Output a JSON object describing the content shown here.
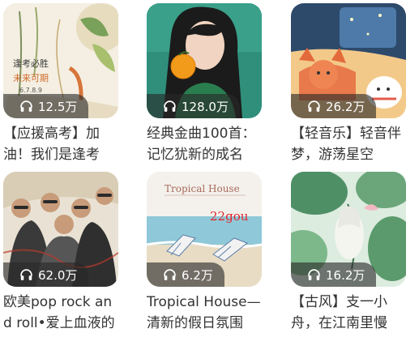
{
  "playlists": [
    {
      "play_count": "12.5万",
      "title": "【应援高考】加油！我们是逢考",
      "cover_icon": "cover-art-exam",
      "cover_text": {
        "line1": "逢考必胜",
        "line2": "未来可期",
        "line3": "6.7.8.9"
      }
    },
    {
      "play_count": "128.0万",
      "title": "经典金曲100首：记忆犹新的成名",
      "cover_icon": "cover-art-singer-orange"
    },
    {
      "play_count": "26.2万",
      "title": "【轻音乐】轻音伴梦，游荡星空",
      "cover_icon": "cover-art-fox-night"
    },
    {
      "play_count": "62.0万",
      "title": "欧美pop rock and roll•爱上血液的",
      "cover_icon": "cover-art-band"
    },
    {
      "play_count": "6.2万",
      "title": "Tropical House—清新的假日氛围",
      "cover_icon": "cover-art-beach",
      "cover_text": {
        "line1": "Tropical House",
        "line2": "22gou"
      }
    },
    {
      "play_count": "16.2万",
      "title": "【古风】支一小舟，在江南里慢",
      "cover_icon": "cover-art-lotus"
    }
  ],
  "colors": {
    "badge_bg": "rgba(40,40,40,0.62)",
    "title_text": "#333333",
    "accent_red": "#e0262b"
  }
}
